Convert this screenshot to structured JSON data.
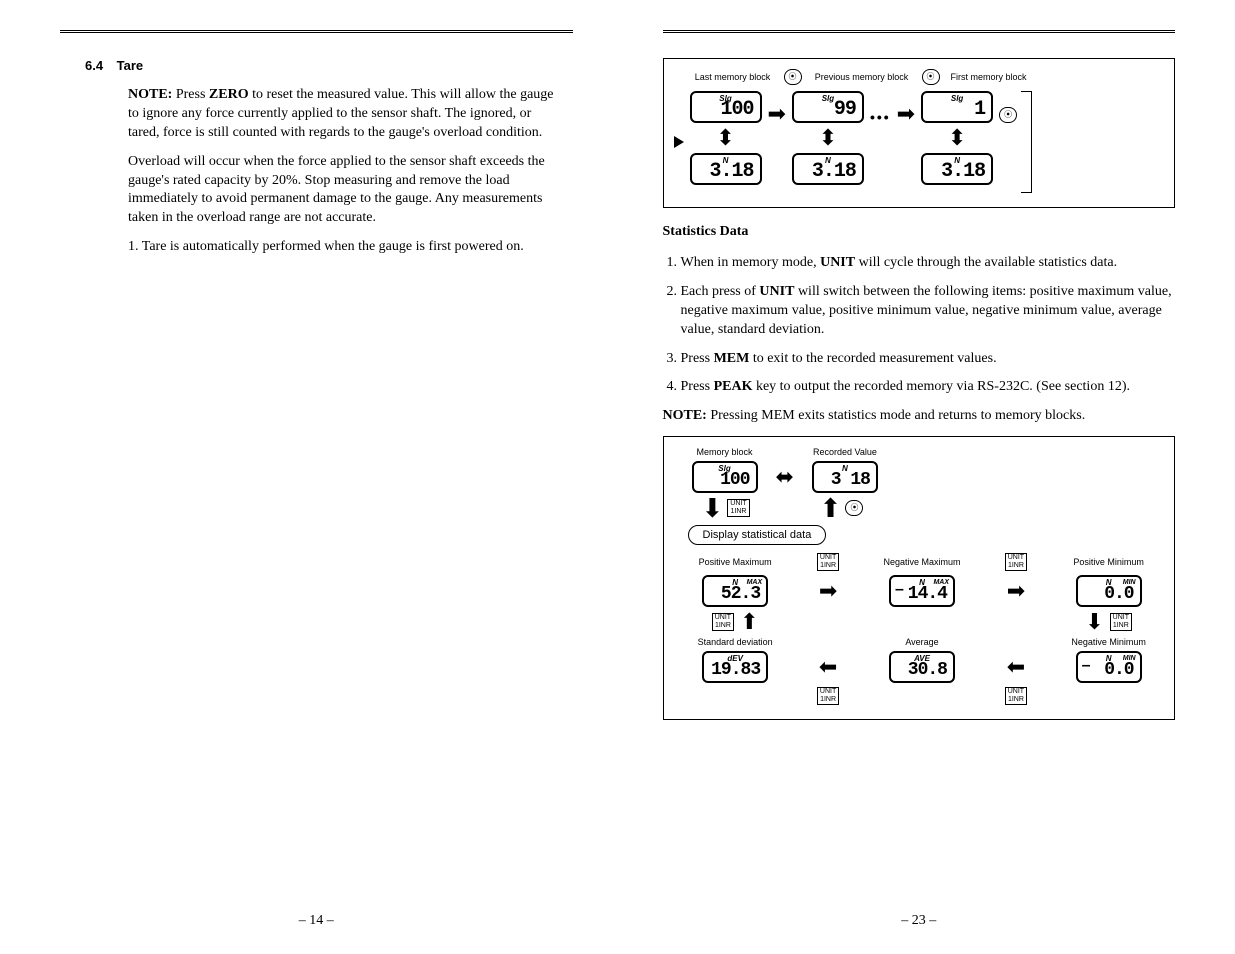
{
  "left": {
    "section_num": "6.4",
    "section_title": "Tare",
    "note_label": "NOTE:",
    "note1_a": " Press ",
    "note1_bold": "ZERO",
    "note1_b": " to reset the measured value. This will allow the gauge to ignore any force currently applied to the sensor shaft. The ignored, or tared, force is still counted with regards to the gauge's overload condition.",
    "para2": "Overload will occur when the force applied to the sensor shaft exceeds the gauge's rated capacity by 20%. Stop measuring and remove the load immediately to avoid permanent damage to the gauge. Any measurements taken in the overload range are not accurate.",
    "item1": "1. Tare is automatically performed when the gauge is first powered on.",
    "pagenum": "– 14 –"
  },
  "right": {
    "fig1": {
      "last": "Last memory block",
      "prev": "Previous memory block",
      "first": "First memory block",
      "slg": "Slg",
      "v1": "100",
      "v2": "99",
      "v3": "1",
      "n": "N",
      "val": "3.18",
      "btn": "⏻"
    },
    "stats_head": "Statistics Data",
    "li1a": "When in memory mode, ",
    "li1bold": "UNIT",
    "li1b": " will cycle through the available statistics data.",
    "li2a": "Each press of ",
    "li2bold": "UNIT",
    "li2b": " will switch between the following items: positive maximum value, negative maximum value, positive minimum value, negative minimum value, average value, standard deviation.",
    "li3a": "Press ",
    "li3bold": "MEM",
    "li3b": " to exit to the recorded measurement values.",
    "li4a": "Press ",
    "li4bold": "PEAK",
    "li4b": " key to output the recorded memory via RS-232C. (See section 12).",
    "note_label": "NOTE:",
    "note2": " Pressing MEM exits statistics mode and returns to memory blocks.",
    "fig2": {
      "mem_block": "Memory block",
      "rec_val": "Recorded Value",
      "slg": "Slg",
      "n": "N",
      "v100": "100",
      "v318": "3 18",
      "stat_label": "Display statistical data",
      "pos_max": "Positive Maximum",
      "neg_max": "Negative Maximum",
      "pos_min": "Positive Minimum",
      "std_dev": "Standard deviation",
      "average": "Average",
      "neg_min": "Negative Minimum",
      "max": "MAX",
      "min": "MIN",
      "ave": "AVE",
      "dev": "dEV",
      "v523": "52.3",
      "v144": "14.4",
      "v00": "0.0",
      "v1983": "19.83",
      "v308": "30.8",
      "unit_btn": "UNIT\n1INR"
    },
    "pagenum": "– 23 –"
  }
}
